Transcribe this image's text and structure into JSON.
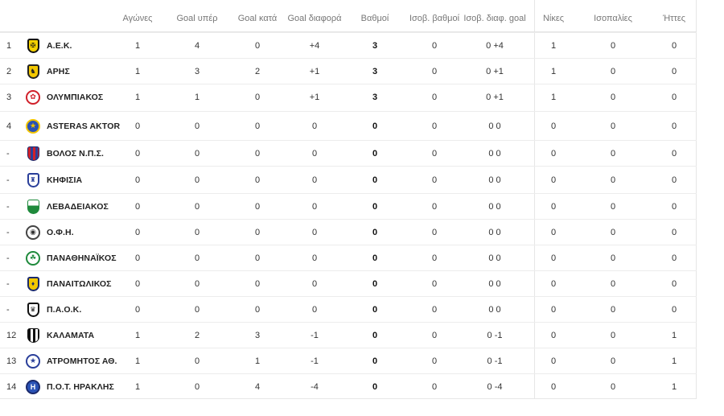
{
  "columns": [
    "Αγώνες",
    "Goal υπέρ",
    "Goal κατά",
    "Goal διαφορά",
    "Βαθμοί",
    "Ισοβ. βαθμοί",
    "Ισοβ. διαφ. goal",
    "Νίκες",
    "Ισοπαλίες",
    "Ήττες"
  ],
  "rows": [
    {
      "rank": "1",
      "team": "Α.Ε.Κ.",
      "logo": "aek-logo",
      "games": "1",
      "gf": "4",
      "ga": "0",
      "gd": "+4",
      "pts": "3",
      "tie_pts": "0",
      "tie_gd": "0 +4",
      "w": "1",
      "d": "0",
      "l": "0"
    },
    {
      "rank": "2",
      "team": "ΑΡΗΣ",
      "logo": "aris-logo",
      "games": "1",
      "gf": "3",
      "ga": "2",
      "gd": "+1",
      "pts": "3",
      "tie_pts": "0",
      "tie_gd": "0 +1",
      "w": "1",
      "d": "0",
      "l": "0"
    },
    {
      "rank": "3",
      "team": "ΟΛΥΜΠΙΑΚΟΣ",
      "logo": "olympiakos-logo",
      "games": "1",
      "gf": "1",
      "ga": "0",
      "gd": "+1",
      "pts": "3",
      "tie_pts": "0",
      "tie_gd": "0 +1",
      "w": "1",
      "d": "0",
      "l": "0"
    },
    {
      "rank": "4",
      "team": "ASTERAS AKTOR",
      "logo": "asteras-logo",
      "games": "0",
      "gf": "0",
      "ga": "0",
      "gd": "0",
      "pts": "0",
      "tie_pts": "0",
      "tie_gd": "0 0",
      "w": "0",
      "d": "0",
      "l": "0"
    },
    {
      "rank": "-",
      "team": "ΒΟΛΟΣ Ν.Π.Σ.",
      "logo": "volos-logo",
      "games": "0",
      "gf": "0",
      "ga": "0",
      "gd": "0",
      "pts": "0",
      "tie_pts": "0",
      "tie_gd": "0 0",
      "w": "0",
      "d": "0",
      "l": "0"
    },
    {
      "rank": "-",
      "team": "ΚΗΦΙΣΙΑ",
      "logo": "kifisia-logo",
      "games": "0",
      "gf": "0",
      "ga": "0",
      "gd": "0",
      "pts": "0",
      "tie_pts": "0",
      "tie_gd": "0 0",
      "w": "0",
      "d": "0",
      "l": "0"
    },
    {
      "rank": "-",
      "team": "ΛΕΒΑΔΕΙΑΚΟΣ",
      "logo": "levadiakos-logo",
      "games": "0",
      "gf": "0",
      "ga": "0",
      "gd": "0",
      "pts": "0",
      "tie_pts": "0",
      "tie_gd": "0 0",
      "w": "0",
      "d": "0",
      "l": "0"
    },
    {
      "rank": "-",
      "team": "Ο.Φ.Η.",
      "logo": "ofi-logo",
      "games": "0",
      "gf": "0",
      "ga": "0",
      "gd": "0",
      "pts": "0",
      "tie_pts": "0",
      "tie_gd": "0 0",
      "w": "0",
      "d": "0",
      "l": "0"
    },
    {
      "rank": "-",
      "team": "ΠΑΝΑΘΗΝΑΪΚΟΣ",
      "logo": "panathinaikos-logo",
      "games": "0",
      "gf": "0",
      "ga": "0",
      "gd": "0",
      "pts": "0",
      "tie_pts": "0",
      "tie_gd": "0 0",
      "w": "0",
      "d": "0",
      "l": "0"
    },
    {
      "rank": "-",
      "team": "ΠΑΝΑΙΤΩΛΙΚΟΣ",
      "logo": "panaitolikos-logo",
      "games": "0",
      "gf": "0",
      "ga": "0",
      "gd": "0",
      "pts": "0",
      "tie_pts": "0",
      "tie_gd": "0 0",
      "w": "0",
      "d": "0",
      "l": "0"
    },
    {
      "rank": "-",
      "team": "Π.Α.Ο.Κ.",
      "logo": "paok-logo",
      "games": "0",
      "gf": "0",
      "ga": "0",
      "gd": "0",
      "pts": "0",
      "tie_pts": "0",
      "tie_gd": "0 0",
      "w": "0",
      "d": "0",
      "l": "0"
    },
    {
      "rank": "12",
      "team": "ΚΑΛΑΜΑΤΑ",
      "logo": "kalamata-logo",
      "games": "1",
      "gf": "2",
      "ga": "3",
      "gd": "-1",
      "pts": "0",
      "tie_pts": "0",
      "tie_gd": "0 -1",
      "w": "0",
      "d": "0",
      "l": "1"
    },
    {
      "rank": "13",
      "team": "ΑΤΡΟΜΗΤΟΣ ΑΘ.",
      "logo": "atromitos-logo",
      "games": "1",
      "gf": "0",
      "ga": "1",
      "gd": "-1",
      "pts": "0",
      "tie_pts": "0",
      "tie_gd": "0 -1",
      "w": "0",
      "d": "0",
      "l": "1"
    },
    {
      "rank": "14",
      "team": "Π.Ο.Τ. ΗΡΑΚΛΗΣ",
      "logo": "iraklis-logo",
      "games": "1",
      "gf": "0",
      "ga": "4",
      "gd": "-4",
      "pts": "0",
      "tie_pts": "0",
      "tie_gd": "0 -4",
      "w": "0",
      "d": "0",
      "l": "1"
    }
  ]
}
